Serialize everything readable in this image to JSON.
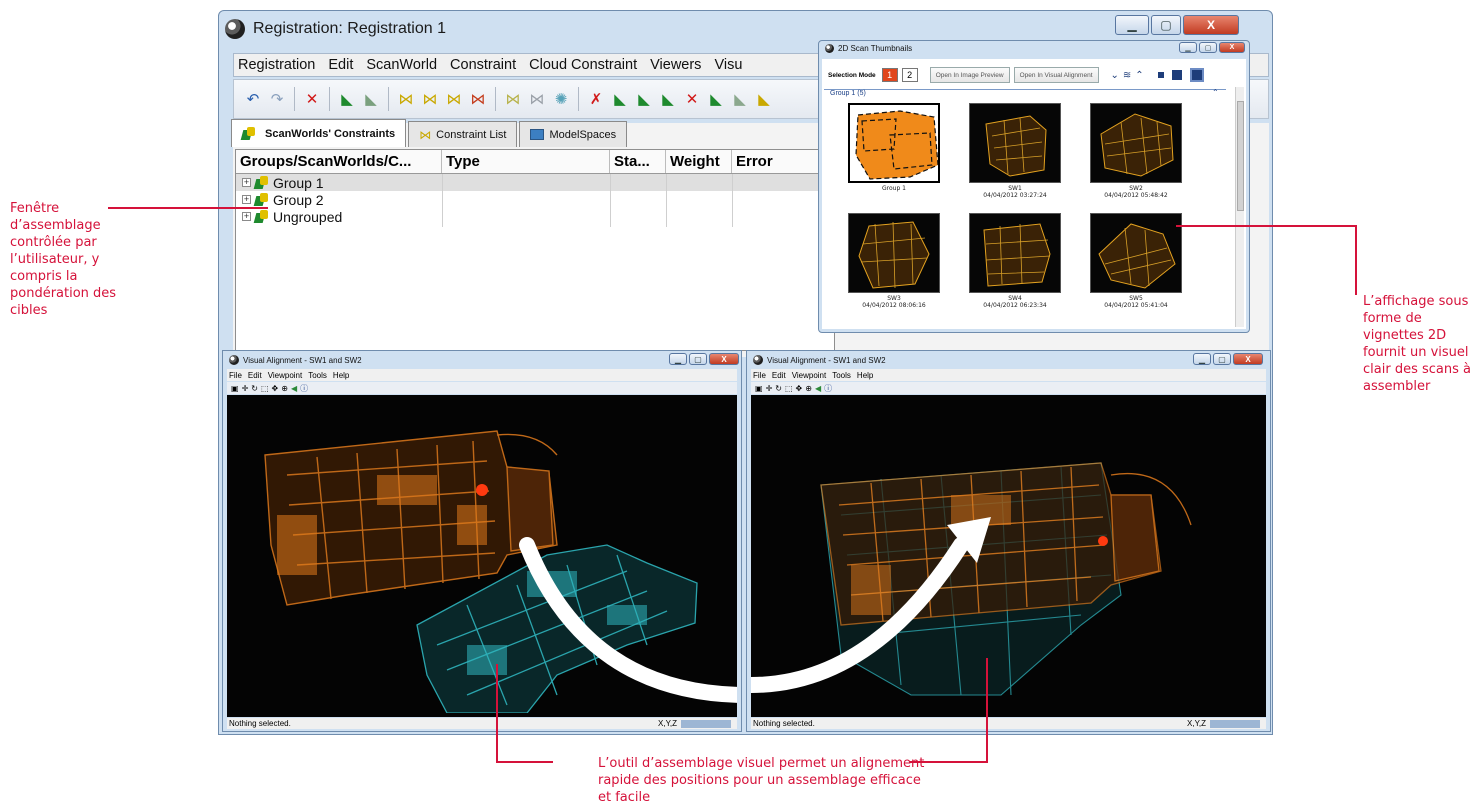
{
  "main_window": {
    "title": "Registration: Registration 1",
    "menu": [
      "Registration",
      "Edit",
      "ScanWorld",
      "Constraint",
      "Cloud Constraint",
      "Viewers",
      "Visu"
    ],
    "tabs": [
      "ScanWorlds' Constraints",
      "Constraint List",
      "ModelSpaces"
    ],
    "columns": [
      "Groups/ScanWorlds/C...",
      "Type",
      "Sta...",
      "Weight",
      "Error"
    ],
    "rows": [
      "Group 1",
      "Group 2",
      "Ungrouped"
    ]
  },
  "thumbnails_window": {
    "title": "2D Scan Thumbnails",
    "selection_mode_label": "Selection Mode",
    "mode_1": "1",
    "mode_2": "2",
    "btn_image_preview": "Open In Image Preview",
    "btn_visual_alignment": "Open In Visual Alignment",
    "group_label": "Group 1 (5)",
    "thumbs": [
      {
        "name": "Group 1",
        "date": ""
      },
      {
        "name": "SW1",
        "date": "04/04/2012 03:27:24"
      },
      {
        "name": "SW2",
        "date": "04/04/2012 05:48:42"
      },
      {
        "name": "SW3",
        "date": "04/04/2012 08:06:16"
      },
      {
        "name": "SW4",
        "date": "04/04/2012 06:23:34"
      },
      {
        "name": "SW5",
        "date": "04/04/2012 05:41:04"
      }
    ]
  },
  "viewer_left": {
    "title": "Visual Alignment - SW1 and SW2",
    "menu": [
      "File",
      "Edit",
      "Viewpoint",
      "Tools",
      "Help"
    ],
    "status": "Nothing selected.",
    "coords": "X,Y,Z"
  },
  "viewer_right": {
    "title": "Visual Alignment - SW1 and SW2",
    "menu": [
      "File",
      "Edit",
      "Viewpoint",
      "Tools",
      "Help"
    ],
    "status": "Nothing selected.",
    "coords": "X,Y,Z"
  },
  "annotations": {
    "left": "Fenêtre d’assemblage contrôlée par l’utilisateur, y compris la pondération des cibles",
    "right": "L’affichage sous forme de vignettes 2D fournit un visuel clair des scans à assembler",
    "bottom": "L’outil d’assemblage visuel permet un alignement rapide des positions pour un assemblage efficace et facile"
  },
  "colors": {
    "annotation": "#d5123a",
    "scan_orange": "#e07a1c",
    "scan_cyan": "#2fb6bf",
    "window_frame": "#cfe0f1"
  },
  "icons": [
    "undo-icon",
    "redo-icon",
    "delete-icon",
    "scanworld-icon",
    "window-close-icon",
    "window-minimize-icon",
    "window-maximize-icon"
  ]
}
